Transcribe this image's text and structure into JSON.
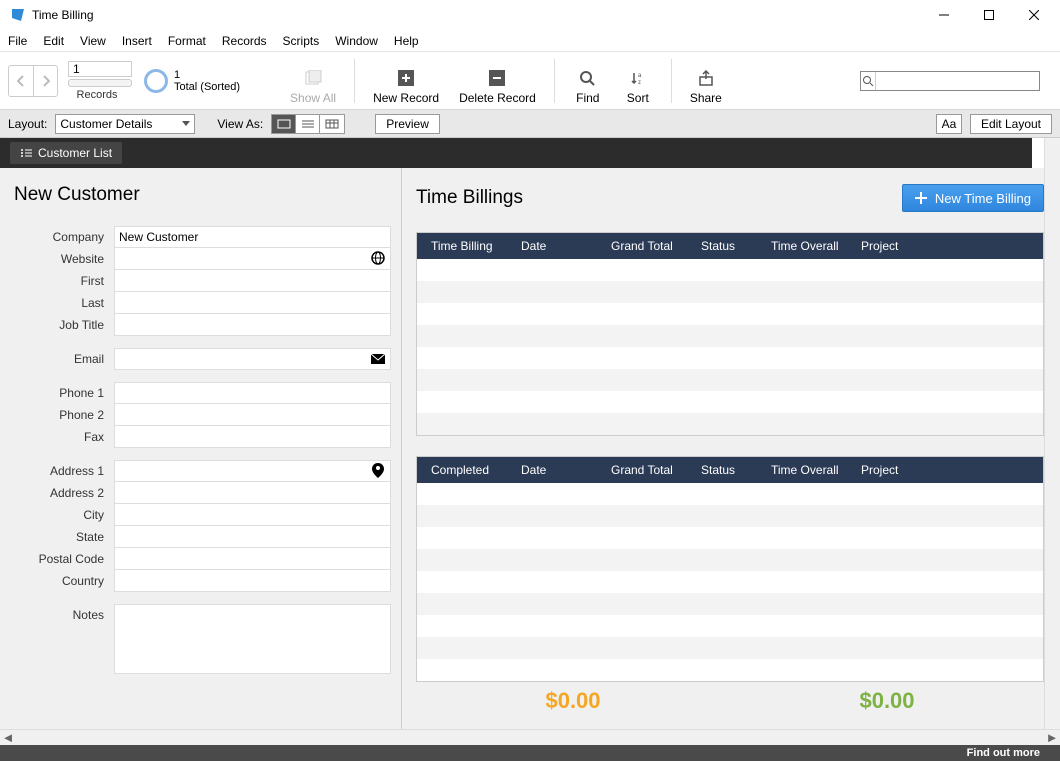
{
  "window": {
    "title": "Time Billing"
  },
  "menu": {
    "file": "File",
    "edit": "Edit",
    "view": "View",
    "insert": "Insert",
    "format": "Format",
    "records": "Records",
    "scripts": "Scripts",
    "window": "Window",
    "help": "Help"
  },
  "toolbar": {
    "record_number": "1",
    "records_label": "Records",
    "found_count": "1",
    "found_label": "Total (Sorted)",
    "show_all": "Show All",
    "new_record": "New Record",
    "delete_record": "Delete Record",
    "find": "Find",
    "sort": "Sort",
    "share": "Share",
    "search_value": ""
  },
  "layoutbar": {
    "layout_label": "Layout:",
    "layout_value": "Customer Details",
    "viewas_label": "View As:",
    "preview": "Preview",
    "aa": "Aa",
    "edit_layout": "Edit Layout"
  },
  "darkbar": {
    "customer_list": "Customer List"
  },
  "left": {
    "title": "New Customer",
    "labels": {
      "company": "Company",
      "website": "Website",
      "first": "First",
      "last": "Last",
      "job_title": "Job Title",
      "email": "Email",
      "phone1": "Phone 1",
      "phone2": "Phone 2",
      "fax": "Fax",
      "address1": "Address 1",
      "address2": "Address 2",
      "city": "City",
      "state": "State",
      "postal": "Postal Code",
      "country": "Country",
      "notes": "Notes"
    },
    "values": {
      "company": "New Customer"
    }
  },
  "right": {
    "title": "Time Billings",
    "new_btn": "New Time Billing",
    "cols1": {
      "c1": "Time Billing",
      "c2": "Date",
      "c3": "Grand Total",
      "c4": "Status",
      "c5": "Time Overall",
      "c6": "Project"
    },
    "cols2": {
      "c1": "Completed",
      "c2": "Date",
      "c3": "Grand Total",
      "c4": "Status",
      "c5": "Time Overall",
      "c6": "Project"
    },
    "total1": "$0.00",
    "total2": "$0.00"
  },
  "bottom": {
    "text": "Find out more"
  }
}
